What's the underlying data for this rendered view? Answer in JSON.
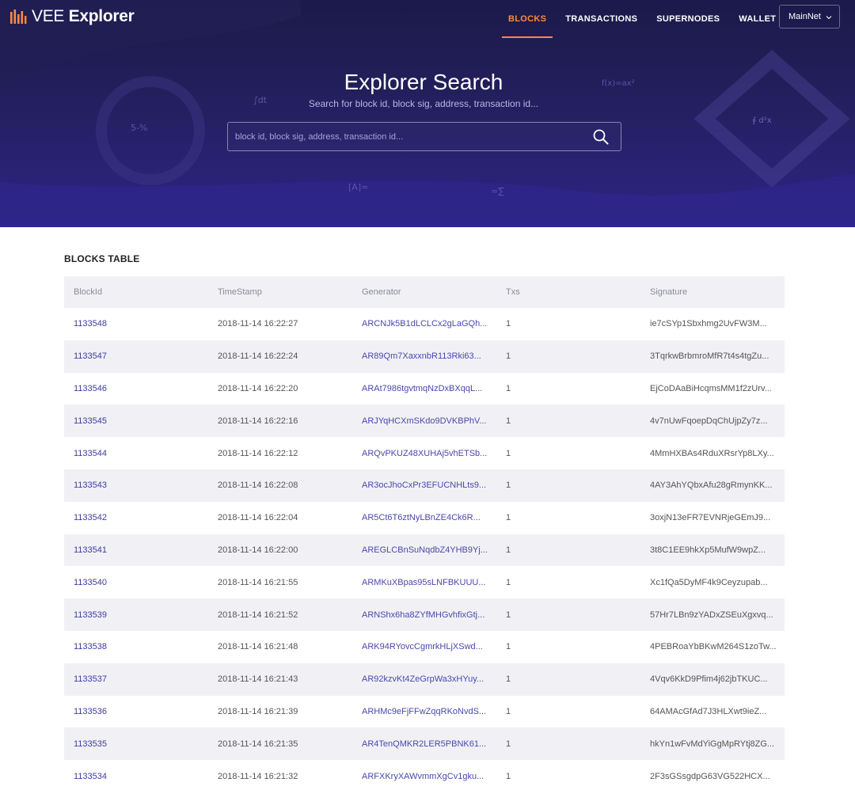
{
  "header": {
    "logo_light": "VEE",
    "logo_bold": "Explorer",
    "nav": [
      {
        "label": "BLOCKS",
        "active": true
      },
      {
        "label": "TRANSACTIONS",
        "active": false
      },
      {
        "label": "SUPERNODES",
        "active": false
      },
      {
        "label": "WALLET",
        "active": false
      }
    ],
    "network": "MainNet"
  },
  "search": {
    "title": "Explorer Search",
    "subtitle": "Search for block id, block sig, address, transaction id...",
    "placeholder": "block id, block sig, address, transaction id...",
    "value": ""
  },
  "colors": {
    "accent": "#ff8a3d",
    "hero_dark": "#1b1a4a",
    "hero_light": "#2e2486",
    "link": "#4b46b0"
  },
  "blocks": {
    "title": "BLOCKS TABLE",
    "columns": [
      "BlockId",
      "TimeStamp",
      "Generator",
      "Txs",
      "Signature"
    ],
    "rows": [
      {
        "id": "1133548",
        "time": "2018-11-14 16:22:27",
        "generator": "ARCNJk5B1dLCLCx2gLaGQh...",
        "txs": "1",
        "sig": "ie7cSYp1Sbxhmg2UvFW3M..."
      },
      {
        "id": "1133547",
        "time": "2018-11-14 16:22:24",
        "generator": "AR89Qm7XaxxnbR113Rki63...",
        "txs": "1",
        "sig": "3TqrkwBrbmroMfR7t4s4tgZu..."
      },
      {
        "id": "1133546",
        "time": "2018-11-14 16:22:20",
        "generator": "ARAt7986tgvtmqNzDxBXqqL...",
        "txs": "1",
        "sig": "EjCoDAaBiHcqmsMM1f2zUrv..."
      },
      {
        "id": "1133545",
        "time": "2018-11-14 16:22:16",
        "generator": "ARJYqHCXmSKdo9DVKBPhV...",
        "txs": "1",
        "sig": "4v7nUwFqoepDqChUjpZy7z..."
      },
      {
        "id": "1133544",
        "time": "2018-11-14 16:22:12",
        "generator": "ARQvPKUZ48XUHAj5vhETSb...",
        "txs": "1",
        "sig": "4MmHXBAs4RduXRsrYp8LXy..."
      },
      {
        "id": "1133543",
        "time": "2018-11-14 16:22:08",
        "generator": "AR3ocJhoCxPr3EFUCNHLts9...",
        "txs": "1",
        "sig": "4AY3AhYQbxAfu28gRmynKK..."
      },
      {
        "id": "1133542",
        "time": "2018-11-14 16:22:04",
        "generator": "AR5Ct6T6ztNyLBnZE4Ck6R...",
        "txs": "1",
        "sig": "3oxjN13eFR7EVNRjeGEmJ9..."
      },
      {
        "id": "1133541",
        "time": "2018-11-14 16:22:00",
        "generator": "AREGLCBnSuNqdbZ4YHB9Yj...",
        "txs": "1",
        "sig": "3t8C1EE9hkXp5MufW9wpZ..."
      },
      {
        "id": "1133540",
        "time": "2018-11-14 16:21:55",
        "generator": "ARMKuXBpas95sLNFBKUUU...",
        "txs": "1",
        "sig": "Xc1fQa5DyMF4k9Ceyzupab..."
      },
      {
        "id": "1133539",
        "time": "2018-11-14 16:21:52",
        "generator": "ARNShx6ha8ZYfMHGvhfixGtj...",
        "txs": "1",
        "sig": "57Hr7LBn9zYADxZSEuXgxvq..."
      },
      {
        "id": "1133538",
        "time": "2018-11-14 16:21:48",
        "generator": "ARK94RYovcCgmrkHLjXSwd...",
        "txs": "1",
        "sig": "4PEBRoaYbBKwM264S1zoTw..."
      },
      {
        "id": "1133537",
        "time": "2018-11-14 16:21:43",
        "generator": "AR92kzvKt4ZeGrpWa3xHYuy...",
        "txs": "1",
        "sig": "4Vqv6KkD9Pfim4j62jbTKUC..."
      },
      {
        "id": "1133536",
        "time": "2018-11-14 16:21:39",
        "generator": "ARHMc9eFjFFwZqqRKoNvdS...",
        "txs": "1",
        "sig": "64AMAcGfAd7J3HLXwt9ieZ..."
      },
      {
        "id": "1133535",
        "time": "2018-11-14 16:21:35",
        "generator": "AR4TenQMKR2LER5PBNK61...",
        "txs": "1",
        "sig": "hkYn1wFvMdYiGgMpRYtj8ZG..."
      },
      {
        "id": "1133534",
        "time": "2018-11-14 16:21:32",
        "generator": "ARFXKryXAWvmmXgCv1gku...",
        "txs": "1",
        "sig": "2F3sGSsgdpG63VG522HCX..."
      }
    ]
  }
}
